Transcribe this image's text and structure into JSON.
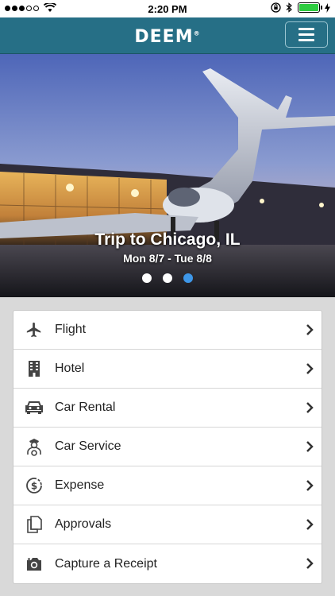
{
  "status_bar": {
    "time": "2:20 PM",
    "signal_bars_filled": 3,
    "signal_bars_total": 5,
    "battery_level": 1.0
  },
  "header": {
    "brand": "DEEM",
    "brand_mark": "®",
    "menu_icon": "hamburger-icon"
  },
  "hero": {
    "title": "Trip to Chicago, IL",
    "dates": "Mon 8/7 - Tue 8/8",
    "slide_count": 3,
    "active_slide": 3
  },
  "menu": {
    "items": [
      {
        "label": "Flight",
        "icon": "airplane-icon"
      },
      {
        "label": "Hotel",
        "icon": "building-icon"
      },
      {
        "label": "Car Rental",
        "icon": "car-icon"
      },
      {
        "label": "Car Service",
        "icon": "chauffeur-icon"
      },
      {
        "label": "Expense",
        "icon": "dollar-cycle-icon"
      },
      {
        "label": "Approvals",
        "icon": "documents-icon"
      },
      {
        "label": "Capture a Receipt",
        "icon": "camera-icon"
      }
    ]
  },
  "colors": {
    "header_bg": "#266f86",
    "active_dot": "#3e97e8",
    "page_bg": "#d9d9d9"
  }
}
